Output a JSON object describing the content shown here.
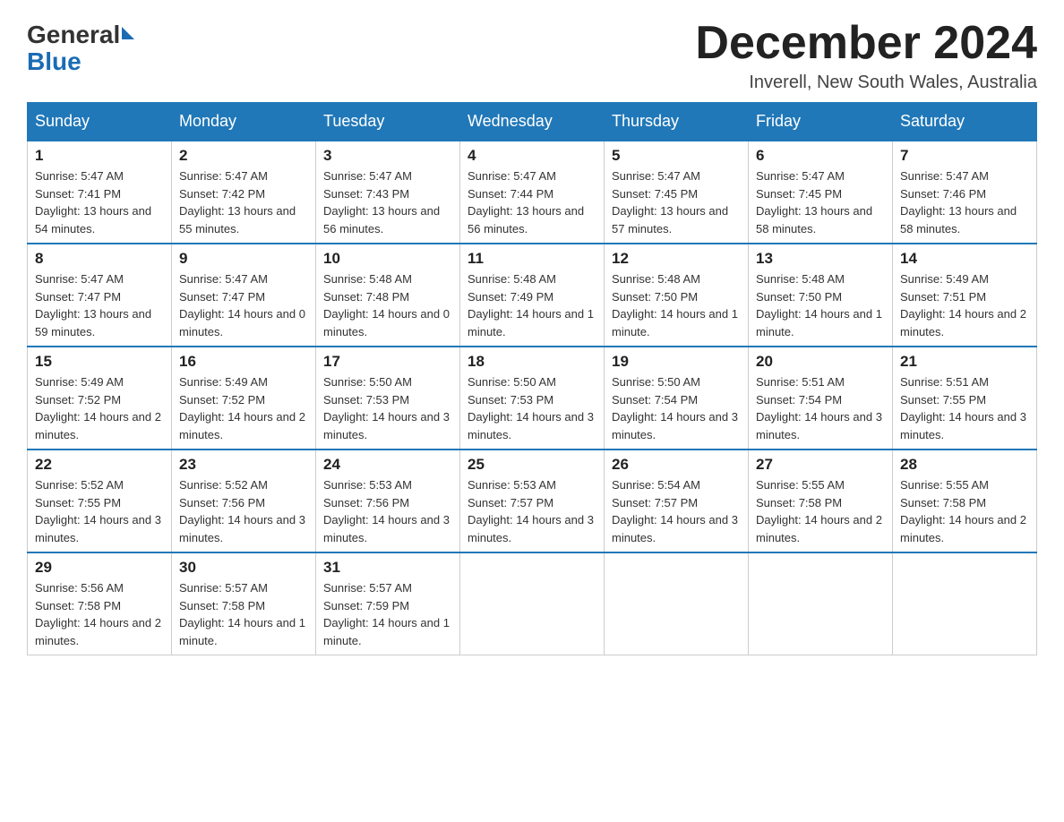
{
  "header": {
    "logo_general": "General",
    "logo_blue": "Blue",
    "month_title": "December 2024",
    "location": "Inverell, New South Wales, Australia"
  },
  "days_of_week": [
    "Sunday",
    "Monday",
    "Tuesday",
    "Wednesday",
    "Thursday",
    "Friday",
    "Saturday"
  ],
  "weeks": [
    [
      {
        "day": "1",
        "sunrise": "5:47 AM",
        "sunset": "7:41 PM",
        "daylight": "13 hours and 54 minutes."
      },
      {
        "day": "2",
        "sunrise": "5:47 AM",
        "sunset": "7:42 PM",
        "daylight": "13 hours and 55 minutes."
      },
      {
        "day": "3",
        "sunrise": "5:47 AM",
        "sunset": "7:43 PM",
        "daylight": "13 hours and 56 minutes."
      },
      {
        "day": "4",
        "sunrise": "5:47 AM",
        "sunset": "7:44 PM",
        "daylight": "13 hours and 56 minutes."
      },
      {
        "day": "5",
        "sunrise": "5:47 AM",
        "sunset": "7:45 PM",
        "daylight": "13 hours and 57 minutes."
      },
      {
        "day": "6",
        "sunrise": "5:47 AM",
        "sunset": "7:45 PM",
        "daylight": "13 hours and 58 minutes."
      },
      {
        "day": "7",
        "sunrise": "5:47 AM",
        "sunset": "7:46 PM",
        "daylight": "13 hours and 58 minutes."
      }
    ],
    [
      {
        "day": "8",
        "sunrise": "5:47 AM",
        "sunset": "7:47 PM",
        "daylight": "13 hours and 59 minutes."
      },
      {
        "day": "9",
        "sunrise": "5:47 AM",
        "sunset": "7:47 PM",
        "daylight": "14 hours and 0 minutes."
      },
      {
        "day": "10",
        "sunrise": "5:48 AM",
        "sunset": "7:48 PM",
        "daylight": "14 hours and 0 minutes."
      },
      {
        "day": "11",
        "sunrise": "5:48 AM",
        "sunset": "7:49 PM",
        "daylight": "14 hours and 1 minute."
      },
      {
        "day": "12",
        "sunrise": "5:48 AM",
        "sunset": "7:50 PM",
        "daylight": "14 hours and 1 minute."
      },
      {
        "day": "13",
        "sunrise": "5:48 AM",
        "sunset": "7:50 PM",
        "daylight": "14 hours and 1 minute."
      },
      {
        "day": "14",
        "sunrise": "5:49 AM",
        "sunset": "7:51 PM",
        "daylight": "14 hours and 2 minutes."
      }
    ],
    [
      {
        "day": "15",
        "sunrise": "5:49 AM",
        "sunset": "7:52 PM",
        "daylight": "14 hours and 2 minutes."
      },
      {
        "day": "16",
        "sunrise": "5:49 AM",
        "sunset": "7:52 PM",
        "daylight": "14 hours and 2 minutes."
      },
      {
        "day": "17",
        "sunrise": "5:50 AM",
        "sunset": "7:53 PM",
        "daylight": "14 hours and 3 minutes."
      },
      {
        "day": "18",
        "sunrise": "5:50 AM",
        "sunset": "7:53 PM",
        "daylight": "14 hours and 3 minutes."
      },
      {
        "day": "19",
        "sunrise": "5:50 AM",
        "sunset": "7:54 PM",
        "daylight": "14 hours and 3 minutes."
      },
      {
        "day": "20",
        "sunrise": "5:51 AM",
        "sunset": "7:54 PM",
        "daylight": "14 hours and 3 minutes."
      },
      {
        "day": "21",
        "sunrise": "5:51 AM",
        "sunset": "7:55 PM",
        "daylight": "14 hours and 3 minutes."
      }
    ],
    [
      {
        "day": "22",
        "sunrise": "5:52 AM",
        "sunset": "7:55 PM",
        "daylight": "14 hours and 3 minutes."
      },
      {
        "day": "23",
        "sunrise": "5:52 AM",
        "sunset": "7:56 PM",
        "daylight": "14 hours and 3 minutes."
      },
      {
        "day": "24",
        "sunrise": "5:53 AM",
        "sunset": "7:56 PM",
        "daylight": "14 hours and 3 minutes."
      },
      {
        "day": "25",
        "sunrise": "5:53 AM",
        "sunset": "7:57 PM",
        "daylight": "14 hours and 3 minutes."
      },
      {
        "day": "26",
        "sunrise": "5:54 AM",
        "sunset": "7:57 PM",
        "daylight": "14 hours and 3 minutes."
      },
      {
        "day": "27",
        "sunrise": "5:55 AM",
        "sunset": "7:58 PM",
        "daylight": "14 hours and 2 minutes."
      },
      {
        "day": "28",
        "sunrise": "5:55 AM",
        "sunset": "7:58 PM",
        "daylight": "14 hours and 2 minutes."
      }
    ],
    [
      {
        "day": "29",
        "sunrise": "5:56 AM",
        "sunset": "7:58 PM",
        "daylight": "14 hours and 2 minutes."
      },
      {
        "day": "30",
        "sunrise": "5:57 AM",
        "sunset": "7:58 PM",
        "daylight": "14 hours and 1 minute."
      },
      {
        "day": "31",
        "sunrise": "5:57 AM",
        "sunset": "7:59 PM",
        "daylight": "14 hours and 1 minute."
      },
      null,
      null,
      null,
      null
    ]
  ],
  "labels": {
    "sunrise_prefix": "Sunrise: ",
    "sunset_prefix": "Sunset: ",
    "daylight_prefix": "Daylight: "
  }
}
